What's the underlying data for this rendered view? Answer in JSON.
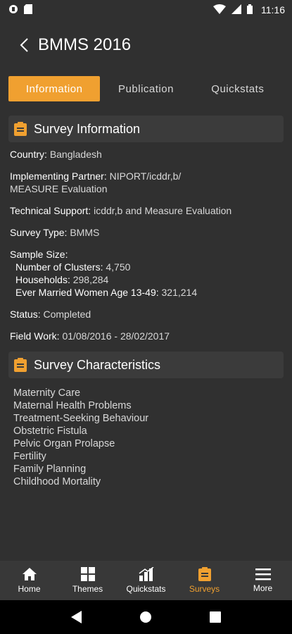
{
  "status_bar": {
    "time": "11:16"
  },
  "header": {
    "title": "BMMS 2016"
  },
  "tabs": [
    {
      "label": "Information",
      "active": true
    },
    {
      "label": "Publication",
      "active": false
    },
    {
      "label": "Quickstats",
      "active": false
    }
  ],
  "survey_info": {
    "title": "Survey Information",
    "country": {
      "label": "Country:",
      "value": "Bangladesh"
    },
    "implementing_partner": {
      "label": "Implementing Partner:",
      "value": "NIPORT/icddr,b/",
      "value_line2": "MEASURE Evaluation"
    },
    "technical_support": {
      "label": "Technical Support:",
      "value": "icddr,b and Measure Evaluation"
    },
    "survey_type": {
      "label": "Survey Type:",
      "value": "BMMS"
    },
    "sample_size": {
      "label": "Sample Size:",
      "clusters": {
        "label": "Number of Clusters:",
        "value": "4,750"
      },
      "households": {
        "label": "Households:",
        "value": "298,284"
      },
      "women": {
        "label": "Ever Married Women Age 13-49:",
        "value": "321,214"
      }
    },
    "status": {
      "label": "Status:",
      "value": "Completed"
    },
    "field_work": {
      "label": "Field Work:",
      "value": "01/08/2016 - 28/02/2017"
    }
  },
  "survey_characteristics": {
    "title": "Survey Characteristics",
    "items": [
      "Maternity Care",
      "Maternal Health Problems",
      "Treatment-Seeking Behaviour",
      "Obstetric Fistula",
      "Pelvic Organ Prolapse",
      "Fertility",
      "Family Planning",
      "Childhood Mortality"
    ]
  },
  "bottom_nav": [
    {
      "label": "Home",
      "icon": "home-icon",
      "active": false
    },
    {
      "label": "Themes",
      "icon": "grid-icon",
      "active": false
    },
    {
      "label": "Quickstats",
      "icon": "bar-chart-icon",
      "active": false
    },
    {
      "label": "Surveys",
      "icon": "clipboard-icon",
      "active": true
    },
    {
      "label": "More",
      "icon": "menu-icon",
      "active": false
    }
  ],
  "colors": {
    "accent": "#f0a030",
    "background": "#303030",
    "header_bg": "#3b3b3b"
  }
}
